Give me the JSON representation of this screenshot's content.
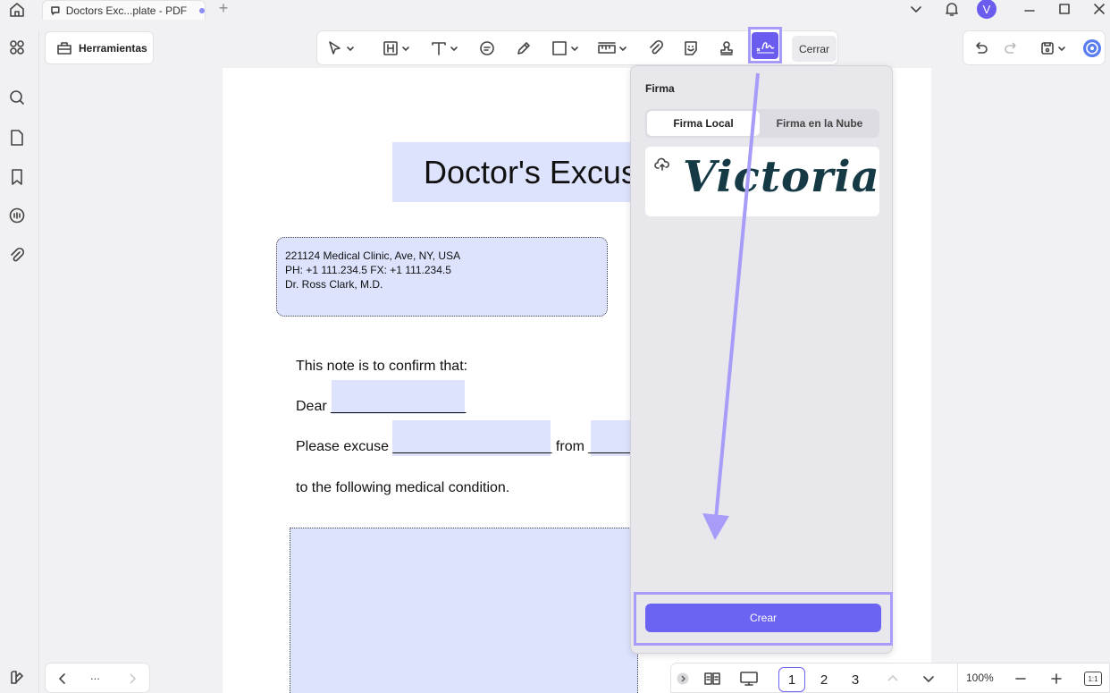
{
  "titlebar": {
    "tab_title": "Doctors Exc...plate - PDF",
    "new_tab_label": "+",
    "avatar_letter": "V"
  },
  "toolbar": {
    "tools_label": "Herramientas",
    "close_label": "Cerrar"
  },
  "document": {
    "title": "Doctor's Excus",
    "clinic_lines": [
      "221124 Medical Clinic, Ave, NY, USA",
      "PH: +1 111.234.5 FX: +1 111.234.5",
      "Dr. Ross Clark, M.D."
    ],
    "line_confirm": "This note is to confirm that:",
    "line_dear": "Dear _________________",
    "line_excuse": "Please excuse ____________________ from ______",
    "line_condition": "to the following medical condition."
  },
  "signature_panel": {
    "title": "Firma",
    "tab_local": "Firma Local",
    "tab_cloud": "Firma en la Nube",
    "signature_text": "Victoria",
    "create_label": "Crear"
  },
  "bottom_bar": {
    "more_label": "...",
    "pages": [
      "1",
      "2",
      "3"
    ],
    "current_page": "1",
    "zoom": "100%",
    "fit_label": "1:1"
  },
  "colors": {
    "accent": "#6b63f2",
    "highlight": "#a79cf8",
    "field_fill": "#dde3fd",
    "signature_ink": "#153a45"
  }
}
